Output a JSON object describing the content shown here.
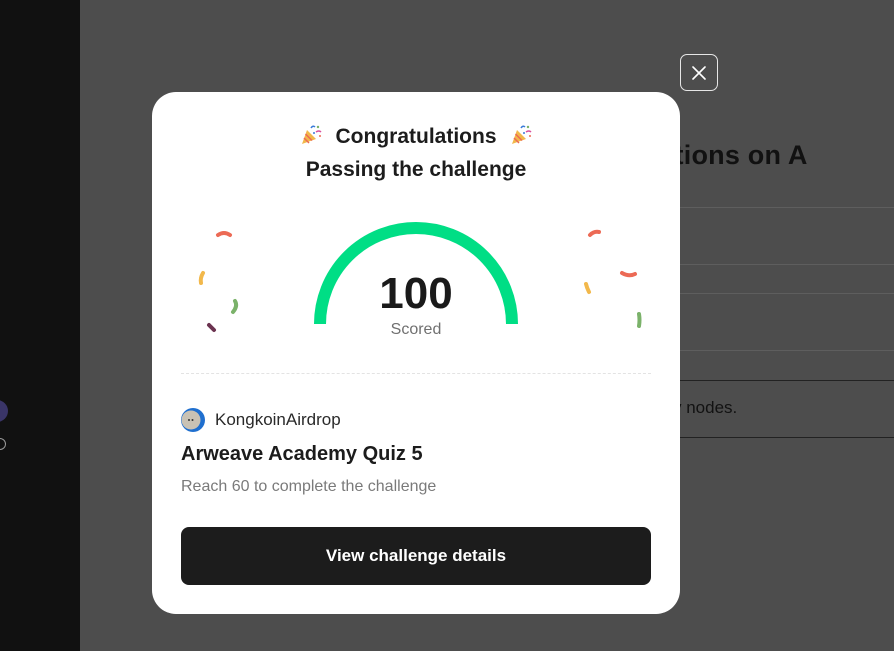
{
  "background": {
    "heading": "ansactions on A",
    "body_text": "y nodes."
  },
  "modal": {
    "title": "Congratulations",
    "subtitle": "Passing the challenge",
    "score": {
      "value": "100",
      "label": "Scored",
      "fraction": 1.0
    },
    "organizer": {
      "name": "KongkoinAirdrop"
    },
    "quiz_title": "Arweave Academy Quiz 5",
    "description": "Reach 60 to complete the challenge",
    "details_button": "View challenge details"
  },
  "colors": {
    "gauge": "#00de85",
    "confetti": [
      "#ec6a55",
      "#f2b84b",
      "#7bb26a",
      "#6b3350"
    ],
    "button_bg": "#1c1c1c",
    "overlay": "#4d4d4d"
  },
  "icons": {
    "close": "close-icon",
    "party": "party-popper-icon",
    "organizer_avatar": "organizer-avatar-icon"
  }
}
